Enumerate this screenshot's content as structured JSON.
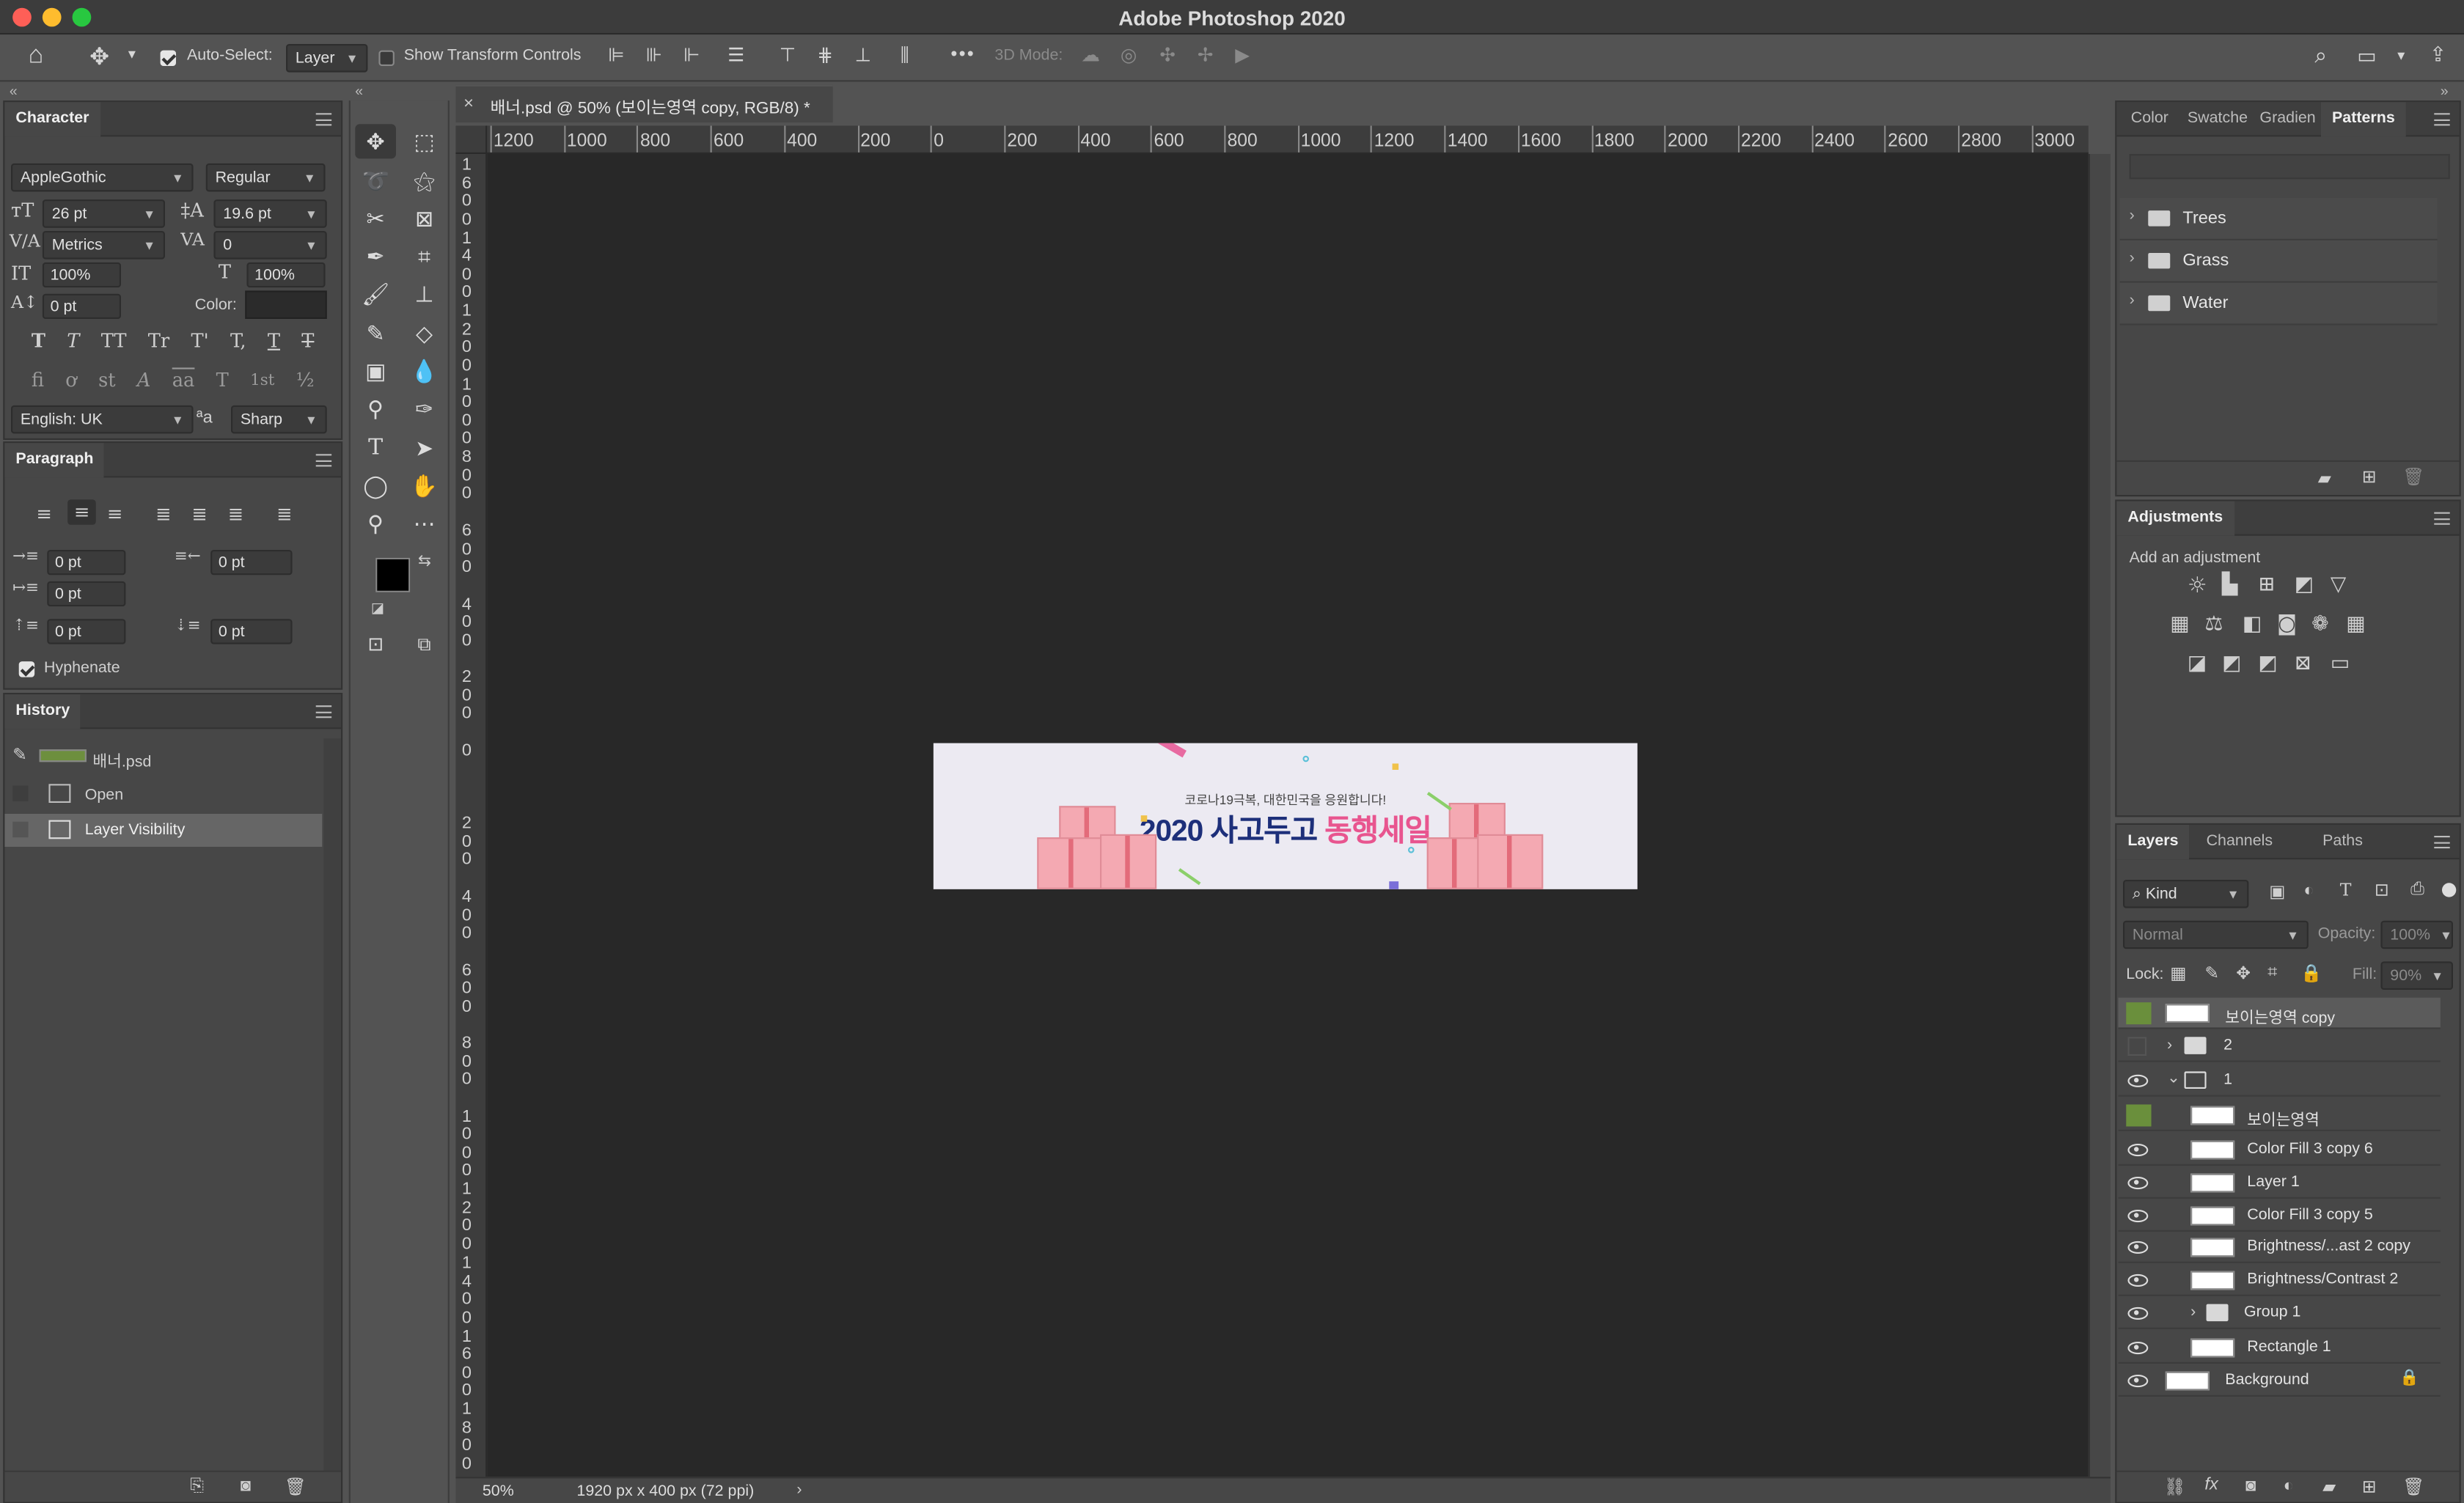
{
  "app": {
    "title": "Adobe Photoshop 2020"
  },
  "options_bar": {
    "auto_select_label": "Auto-Select:",
    "auto_select_value": "Layer",
    "show_transform_label": "Show Transform Controls",
    "three_d_mode_label": "3D Mode:",
    "more_label": "•••"
  },
  "character": {
    "tab": "Character",
    "font_family": "AppleGothic",
    "font_style": "Regular",
    "font_size": "26 pt",
    "leading": "19.6 pt",
    "kerning": "Metrics",
    "tracking": "0",
    "vertical_scale": "100%",
    "horizontal_scale": "100%",
    "baseline_shift": "0 pt",
    "color_label": "Color:",
    "language": "English: UK",
    "aa_glyph": "ªa",
    "antialias": "Sharp",
    "type_buttons": [
      "T",
      "T",
      "TT",
      "Tr",
      "T'",
      "T,",
      "T",
      "T"
    ],
    "opentype_buttons": [
      "fi",
      "ơ",
      "st",
      "A",
      "aa",
      "T",
      "1st",
      "½"
    ]
  },
  "paragraph": {
    "tab": "Paragraph",
    "indent_left": "0 pt",
    "indent_right": "0 pt",
    "indent_first": "0 pt",
    "space_before": "0 pt",
    "space_after": "0 pt",
    "hyphenate_label": "Hyphenate"
  },
  "history": {
    "tab": "History",
    "snapshot": "배너.psd",
    "items": [
      "Open",
      "Layer Visibility"
    ]
  },
  "document": {
    "tab_title": "배너.psd @ 50% (보이는영역 copy, RGB/8) *",
    "zoom": "50%",
    "doc_info": "1920 px x 400 px (72 ppi)",
    "ruler_h": [
      "1200",
      "1000",
      "800",
      "600",
      "400",
      "200",
      "0",
      "200",
      "400",
      "600",
      "800",
      "1000",
      "1200",
      "1400",
      "1600",
      "1800",
      "2000",
      "2200",
      "2400",
      "2600",
      "2800",
      "3000"
    ],
    "ruler_v": [
      "1600",
      "1400",
      "1200",
      "1000",
      "800",
      "600",
      "400",
      "200",
      "0",
      "200",
      "400",
      "600",
      "800",
      "1000",
      "1200",
      "1400",
      "1600",
      "1800"
    ]
  },
  "banner": {
    "subtitle": "코로나19극복, 대한민국을 응원합니다!",
    "title_a": "2020 사고두고",
    "title_b": "동행세일"
  },
  "right_tabs": {
    "color": "Color",
    "swatches": "Swatche",
    "gradients": "Gradien",
    "patterns": "Patterns"
  },
  "patterns": {
    "items": [
      "Trees",
      "Grass",
      "Water"
    ]
  },
  "adjustments": {
    "tab": "Adjustments",
    "subtitle": "Add an adjustment"
  },
  "layers_tabs": {
    "layers": "Layers",
    "channels": "Channels",
    "paths": "Paths"
  },
  "layers_panel": {
    "filter_kind": "Kind",
    "blend_mode": "Normal",
    "opacity_label": "Opacity:",
    "opacity_value": "100%",
    "lock_label": "Lock:",
    "fill_label": "Fill:",
    "fill_value": "90%",
    "layers": [
      {
        "name": "보이는영역 copy"
      },
      {
        "name": "2"
      },
      {
        "name": "1"
      },
      {
        "name": "보이는영역"
      },
      {
        "name": "Color Fill 3 copy 6"
      },
      {
        "name": "Layer 1"
      },
      {
        "name": "Color Fill 3 copy 5"
      },
      {
        "name": "Brightness/...ast 2 copy"
      },
      {
        "name": "Brightness/Contrast 2"
      },
      {
        "name": "Group 1"
      },
      {
        "name": "Rectangle 1"
      },
      {
        "name": "Background"
      }
    ]
  },
  "colors": {
    "accent_green": "#6a8f3c",
    "banner_navy": "#1d2f7a",
    "banner_pink": "#e8558f"
  }
}
